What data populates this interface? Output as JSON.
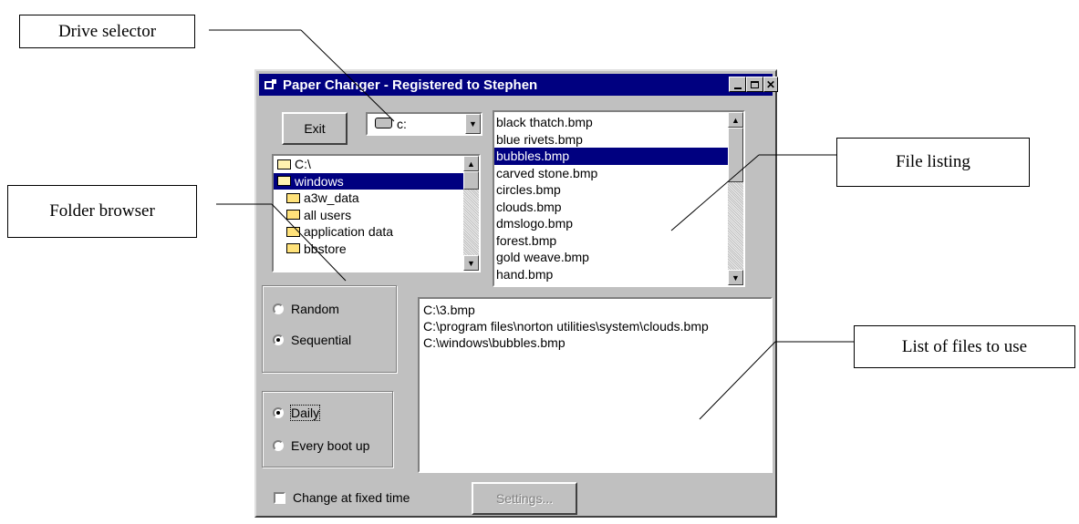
{
  "callouts": {
    "drive": "Drive selector",
    "folder": "Folder browser",
    "files": "File listing",
    "use": "List of files to use"
  },
  "window": {
    "title": "Paper Changer - Registered to Stephen",
    "title_icon": "app-icon"
  },
  "exit_label": "Exit",
  "drive": {
    "value": "c:",
    "icon": "drive-icon"
  },
  "folders": {
    "items": [
      {
        "label": "C:\\"
      },
      {
        "label": "windows"
      },
      {
        "label": "a3w_data"
      },
      {
        "label": "all users"
      },
      {
        "label": "application data"
      },
      {
        "label": "bbstore"
      }
    ],
    "selected": "windows"
  },
  "files": {
    "items": [
      {
        "label": "black thatch.bmp"
      },
      {
        "label": "blue rivets.bmp"
      },
      {
        "label": "bubbles.bmp"
      },
      {
        "label": "carved stone.bmp"
      },
      {
        "label": "circles.bmp"
      },
      {
        "label": "clouds.bmp"
      },
      {
        "label": "dmslogo.bmp"
      },
      {
        "label": "forest.bmp"
      },
      {
        "label": "gold weave.bmp"
      },
      {
        "label": "hand.bmp"
      }
    ],
    "selected": "bubbles.bmp"
  },
  "order": {
    "random": "Random",
    "sequential": "Sequential",
    "selected": "Sequential"
  },
  "frequency": {
    "daily": "Daily",
    "boot": "Every boot up",
    "selected": "Daily"
  },
  "use_list": [
    {
      "path": "C:\\3.bmp"
    },
    {
      "path": "C:\\program files\\norton utilities\\system\\clouds.bmp"
    },
    {
      "path": "C:\\windows\\bubbles.bmp"
    }
  ],
  "fixed_time": {
    "label": "Change at fixed time",
    "checked": false
  },
  "settings_label": "Settings..."
}
